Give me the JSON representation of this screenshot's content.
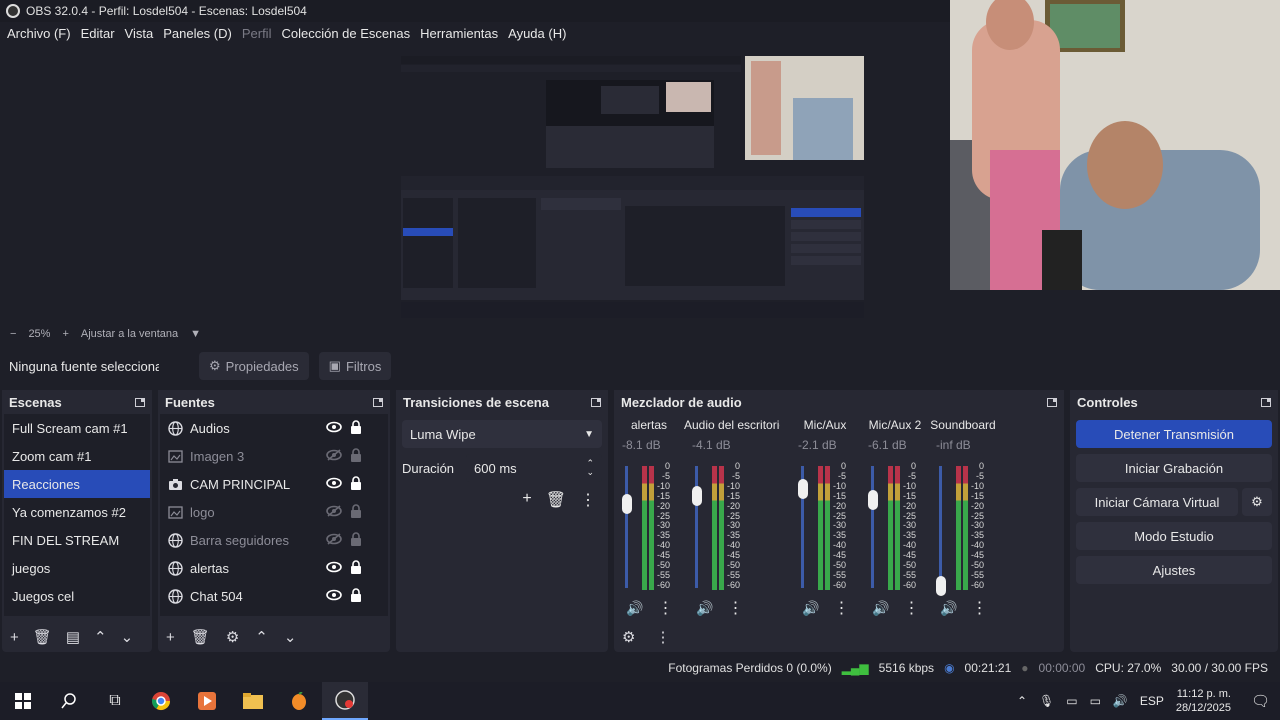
{
  "window": {
    "title": "OBS 32.0.4 - Perfil: Losdel504 - Escenas: Losdel504"
  },
  "menu": [
    {
      "label": "Archivo (F)",
      "disabled": false
    },
    {
      "label": "Editar",
      "disabled": false
    },
    {
      "label": "Vista",
      "disabled": false
    },
    {
      "label": "Paneles (D)",
      "disabled": false
    },
    {
      "label": "Perfil",
      "disabled": true
    },
    {
      "label": "Colección de Escenas",
      "disabled": false
    },
    {
      "label": "Herramientas",
      "disabled": false
    },
    {
      "label": "Ayuda (H)",
      "disabled": false
    }
  ],
  "zoom": {
    "minus": "−",
    "value": "25%",
    "plus": "+",
    "fit_label": "Ajustar a la ventana"
  },
  "context": {
    "no_source": "Ninguna fuente seleccionad",
    "properties": "Propiedades",
    "filters": "Filtros"
  },
  "scenes": {
    "title": "Escenas",
    "items": [
      "Full Scream cam #1",
      "Zoom cam #1",
      "Reacciones",
      "Ya comenzamos #2",
      "FIN DEL STREAM",
      "juegos",
      "Juegos cel"
    ],
    "selected_index": 2
  },
  "sources": {
    "title": "Fuentes",
    "items": [
      {
        "name": "Audios",
        "icon": "globe-icon",
        "visible": true
      },
      {
        "name": "Imagen 3",
        "icon": "image-icon",
        "visible": false
      },
      {
        "name": "CAM PRINCIPAL",
        "icon": "camera-icon",
        "visible": true
      },
      {
        "name": "logo",
        "icon": "image-icon",
        "visible": false
      },
      {
        "name": "Barra seguidores",
        "icon": "globe-icon",
        "visible": false
      },
      {
        "name": "alertas",
        "icon": "globe-icon",
        "visible": true
      },
      {
        "name": "Chat 504",
        "icon": "globe-icon",
        "visible": true
      }
    ]
  },
  "transitions": {
    "title": "Transiciones de escena",
    "selected": "Luma Wipe",
    "duration_label": "Duración",
    "duration_value": "600 ms"
  },
  "mixer": {
    "title": "Mezclador de audio",
    "channels": [
      {
        "name": "alertas",
        "db": "-8.1 dB",
        "fader": 0.75
      },
      {
        "name": "Audio del escritorio",
        "db": "-4.1 dB",
        "fader": 0.82
      },
      {
        "name": "Mic/Aux",
        "db": "-2.1 dB",
        "fader": 0.88
      },
      {
        "name": "Mic/Aux 2",
        "db": "-6.1 dB",
        "fader": 0.78
      },
      {
        "name": "Soundboard",
        "db": "-inf dB",
        "fader": 0.0
      }
    ],
    "scale": [
      "0",
      "-5",
      "-10",
      "-15",
      "-20",
      "-25",
      "-30",
      "-35",
      "-40",
      "-45",
      "-50",
      "-55",
      "-60"
    ]
  },
  "controls": {
    "title": "Controles",
    "buttons": [
      "Detener Transmisión",
      "Iniciar Grabación",
      "Iniciar Cámara Virtual",
      "Modo Estudio",
      "Ajustes"
    ]
  },
  "status": {
    "dropped_frames": "Fotogramas Perdidos 0 (0.0%)",
    "bitrate": "5516 kbps",
    "stream_time": "00:21:21",
    "rec_time": "00:00:00",
    "cpu": "CPU: 27.0%",
    "fps": "30.00 / 30.00 FPS"
  },
  "taskbar": {
    "lang": "ESP",
    "time": "11:12 p. m.",
    "date": "28/12/2025"
  },
  "colors": {
    "accent": "#284cb8",
    "panel": "#272833",
    "bg": "#1e1f28"
  }
}
